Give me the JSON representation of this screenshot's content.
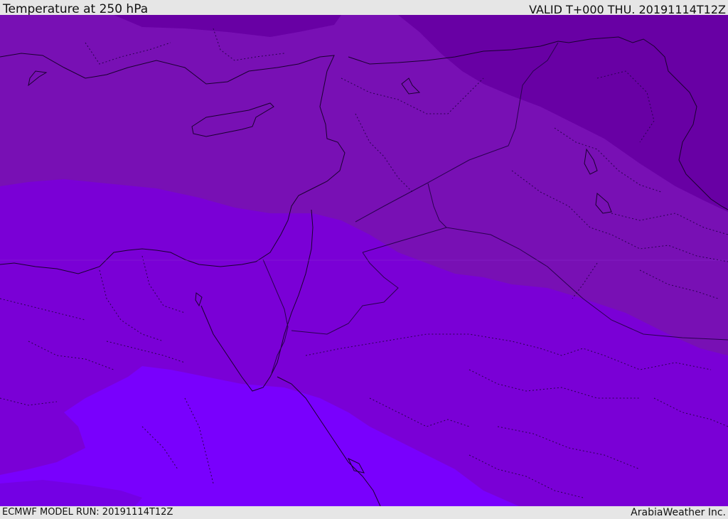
{
  "header": {
    "title": "Temperature at 250 hPa",
    "valid": "VALID T+000 THU. 20191114T12Z"
  },
  "footer": {
    "model_run": "ECMWF MODEL RUN: 20191114T12Z",
    "brand": "ArabiaWeather Inc."
  },
  "map": {
    "colors": {
      "band_darkest": "#6800a4",
      "band_dark": "#7810b4",
      "band_mid": "#7a00d6",
      "band_light": "#7900fd",
      "coastline": "#1a0030",
      "border": "#2a0050",
      "background": "#e6e6e6"
    }
  }
}
